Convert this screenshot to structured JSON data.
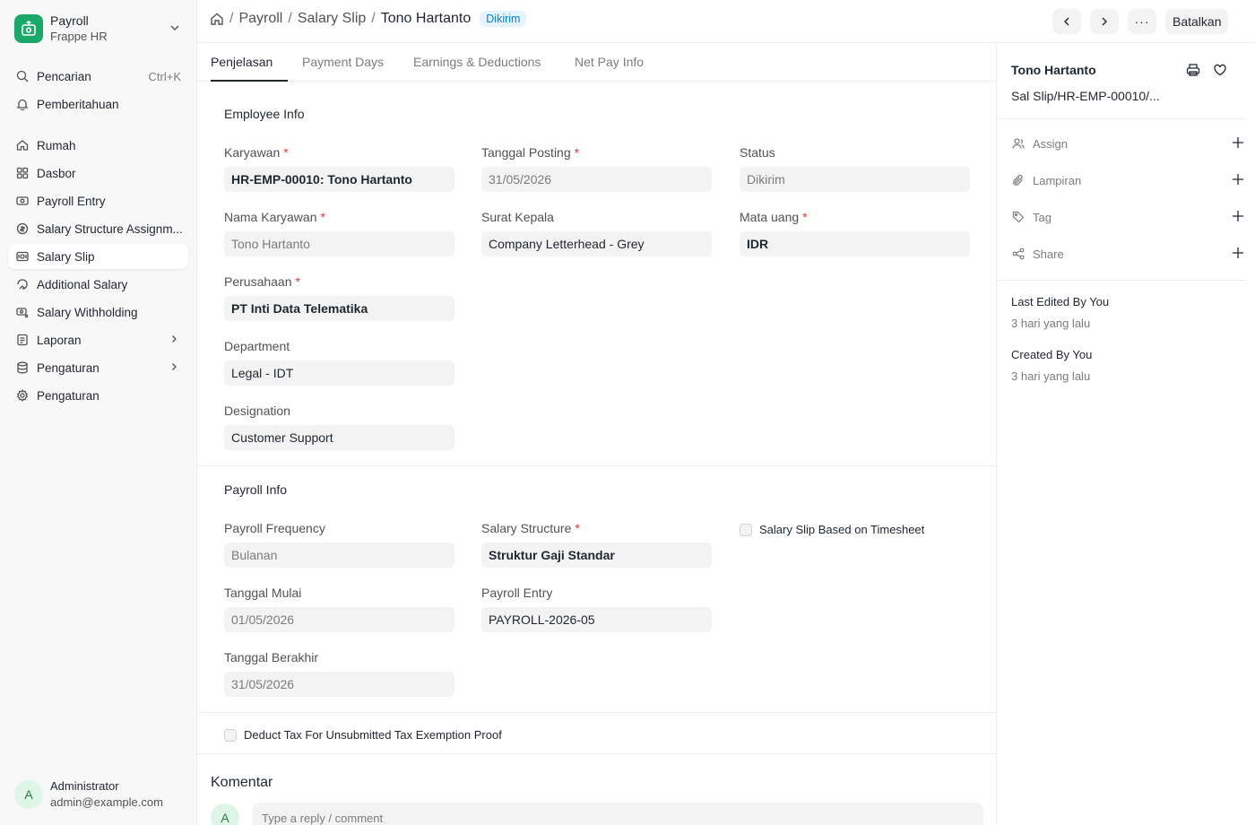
{
  "app": {
    "name": "Payroll",
    "subtitle": "Frappe HR"
  },
  "sidebar": {
    "search": {
      "label": "Pencarian",
      "shortcut": "Ctrl+K"
    },
    "notifications": {
      "label": "Pemberitahuan"
    },
    "items": [
      {
        "label": "Rumah",
        "icon": "home-icon"
      },
      {
        "label": "Dasbor",
        "icon": "dashboard-icon"
      },
      {
        "label": "Payroll Entry",
        "icon": "money-icon"
      },
      {
        "label": "Salary Structure Assignm...",
        "icon": "structure-icon"
      },
      {
        "label": "Salary Slip",
        "icon": "slip-icon",
        "active": true
      },
      {
        "label": "Additional Salary",
        "icon": "gift-icon"
      },
      {
        "label": "Salary Withholding",
        "icon": "withhold-icon"
      },
      {
        "label": "Laporan",
        "icon": "report-icon",
        "has_children": true
      },
      {
        "label": "Pengaturan",
        "icon": "database-icon",
        "has_children": true
      },
      {
        "label": "Pengaturan",
        "icon": "gear-icon"
      }
    ]
  },
  "user": {
    "initial": "A",
    "name": "Administrator",
    "email": "admin@example.com"
  },
  "breadcrumb": {
    "items": [
      "Payroll",
      "Salary Slip"
    ],
    "current": "Tono Hartanto",
    "sep": "/",
    "status": "Dikirim"
  },
  "header": {
    "more": "···",
    "cancel_label": "Batalkan"
  },
  "tabs": [
    {
      "label": "Penjelasan",
      "active": true
    },
    {
      "label": "Payment Days"
    },
    {
      "label": "Earnings & Deductions"
    },
    {
      "label": "Net Pay Info"
    }
  ],
  "employee_info": {
    "title": "Employee Info",
    "req_mark": "*",
    "karyawan": {
      "label": "Karyawan",
      "value": "HR-EMP-00010: Tono Hartanto"
    },
    "tanggal_posting": {
      "label": "Tanggal Posting",
      "value": "31/05/2026"
    },
    "status": {
      "label": "Status",
      "value": "Dikirim"
    },
    "nama_karyawan": {
      "label": "Nama Karyawan",
      "value": "Tono Hartanto"
    },
    "surat_kepala": {
      "label": "Surat Kepala",
      "value": "Company Letterhead - Grey"
    },
    "mata_uang": {
      "label": "Mata uang",
      "value": "IDR"
    },
    "perusahaan": {
      "label": "Perusahaan",
      "value": "PT Inti Data Telematika"
    },
    "department": {
      "label": "Department",
      "value": "Legal - IDT"
    },
    "designation": {
      "label": "Designation",
      "value": "Customer Support"
    }
  },
  "payroll_info": {
    "title": "Payroll Info",
    "frequency": {
      "label": "Payroll Frequency",
      "value": "Bulanan"
    },
    "salary_structure": {
      "label": "Salary Structure",
      "value": "Struktur Gaji Standar"
    },
    "timesheet": {
      "label": "Salary Slip Based on Timesheet",
      "checked": false
    },
    "tanggal_mulai": {
      "label": "Tanggal Mulai",
      "value": "01/05/2026"
    },
    "payroll_entry": {
      "label": "Payroll Entry",
      "value": "PAYROLL-2026-05"
    },
    "tanggal_berakhir": {
      "label": "Tanggal Berakhir",
      "value": "31/05/2026"
    }
  },
  "deduct_tax": {
    "label": "Deduct Tax For Unsubmitted Tax Exemption Proof",
    "checked": false
  },
  "comments": {
    "title": "Komentar",
    "avatar": "A",
    "placeholder": "Type a reply / comment"
  },
  "right_panel": {
    "name": "Tono Hartanto",
    "doc_id": "Sal Slip/HR-EMP-00010/...",
    "assign": "Assign",
    "attachments": "Lampiran",
    "tags": "Tag",
    "share": "Share",
    "last_edited": "Last Edited By You",
    "last_edited_time": "3 hari yang lalu",
    "created": "Created By You",
    "created_time": "3 hari yang lalu"
  },
  "colors": {
    "accent": "#1aa86b",
    "status": "#007be0",
    "required": "#e03636"
  }
}
